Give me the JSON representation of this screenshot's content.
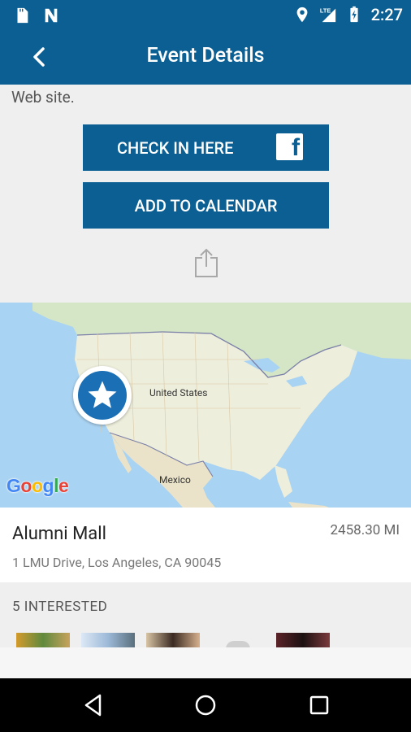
{
  "status_bar": {
    "time": "2:27",
    "network": "LTE",
    "icons": [
      "sd-card-icon",
      "n-notification-icon",
      "location-icon",
      "signal-icon",
      "battery-icon"
    ]
  },
  "app_bar": {
    "title": "Event Details",
    "back_icon": "chevron-left-icon"
  },
  "event": {
    "description_tail": "Web site.",
    "check_in_label": "CHECK IN HERE",
    "calendar_label": "ADD TO CALENDAR",
    "share_icon": "share-icon"
  },
  "map": {
    "labels": {
      "us": "United States",
      "mexico": "Mexico"
    },
    "marker_icon": "star-icon",
    "attribution": "Google"
  },
  "location": {
    "name": "Alumni Mall",
    "distance": "2458.30 MI",
    "address": "1 LMU Drive, Los Angeles, CA 90045"
  },
  "interested": {
    "title": "5 INTERESTED"
  },
  "colors": {
    "brand": "#0b5f92",
    "background": "#efefef"
  }
}
